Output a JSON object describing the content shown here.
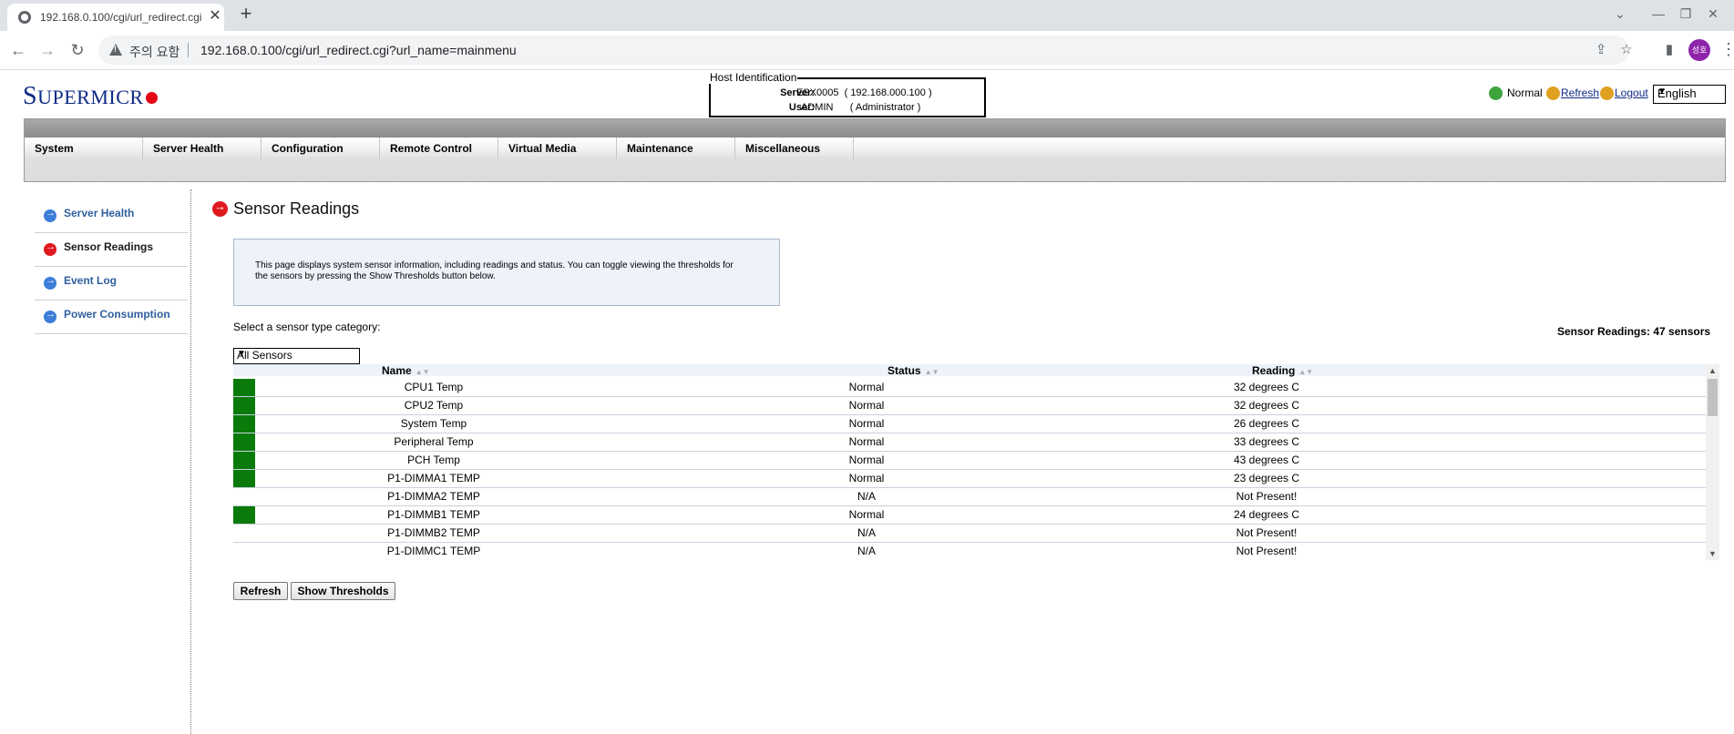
{
  "browser": {
    "tab_title": "192.168.0.100/cgi/url_redirect.cgi",
    "tab_close": "✕",
    "new_tab": "+",
    "back": "←",
    "forward": "→",
    "reload": "↻",
    "insecure_label": "주의 요함",
    "url": "192.168.0.100/cgi/url_redirect.cgi?url_name=mainmenu",
    "profile_initials": "성호",
    "window_controls": [
      "⌄",
      "—",
      "❐",
      "✕"
    ]
  },
  "header": {
    "logo_cap": "S",
    "logo_rest": "UPERMICR",
    "logo_tail": "O",
    "host_legend": "Host Identification",
    "server_label": "Server:",
    "server_value": "ESX0005  ( 192.168.000.100 )",
    "user_label": "User:",
    "user_value": "ADMIN      ( Administrator )",
    "status_normal": "Normal",
    "refresh": "Refresh",
    "logout": "Logout",
    "language": "English"
  },
  "menu": {
    "items": [
      "System",
      "Server Health",
      "Configuration",
      "Remote Control",
      "Virtual Media",
      "Maintenance",
      "Miscellaneous"
    ]
  },
  "sidebar": {
    "items": [
      {
        "label": "Server Health"
      },
      {
        "label": "Sensor Readings"
      },
      {
        "label": "Event Log"
      },
      {
        "label": "Power Consumption"
      }
    ]
  },
  "main": {
    "title": "Sensor Readings",
    "info": "This page displays system sensor information, including readings and status. You can toggle viewing the thresholds for the sensors by pressing the Show Thresholds button below.",
    "select_label": "Select a sensor type category:",
    "select_value": "All Sensors",
    "sensor_count": "Sensor Readings: 47 sensors",
    "columns": [
      "Name",
      "Status",
      "Reading"
    ],
    "rows": [
      {
        "name": "CPU1 Temp",
        "status": "Normal",
        "reading": "32 degrees C",
        "indicator": true
      },
      {
        "name": "CPU2 Temp",
        "status": "Normal",
        "reading": "32 degrees C",
        "indicator": true
      },
      {
        "name": "System Temp",
        "status": "Normal",
        "reading": "26 degrees C",
        "indicator": true
      },
      {
        "name": "Peripheral Temp",
        "status": "Normal",
        "reading": "33 degrees C",
        "indicator": true
      },
      {
        "name": "PCH Temp",
        "status": "Normal",
        "reading": "43 degrees C",
        "indicator": true
      },
      {
        "name": "P1-DIMMA1 TEMP",
        "status": "Normal",
        "reading": "23 degrees C",
        "indicator": true
      },
      {
        "name": "P1-DIMMA2 TEMP",
        "status": "N/A",
        "reading": "Not Present!",
        "indicator": false
      },
      {
        "name": "P1-DIMMB1 TEMP",
        "status": "Normal",
        "reading": "24 degrees C",
        "indicator": true
      },
      {
        "name": "P1-DIMMB2 TEMP",
        "status": "N/A",
        "reading": "Not Present!",
        "indicator": false
      },
      {
        "name": "P1-DIMMC1 TEMP",
        "status": "N/A",
        "reading": "Not Present!",
        "indicator": false
      }
    ],
    "refresh_button": "Refresh",
    "thresholds_button": "Show Thresholds"
  },
  "colors": {
    "status_ok": "#0a7a0a",
    "logo_blue": "#0d2a85",
    "logo_red": "#e30613",
    "link_blue": "#2f5f9e"
  }
}
